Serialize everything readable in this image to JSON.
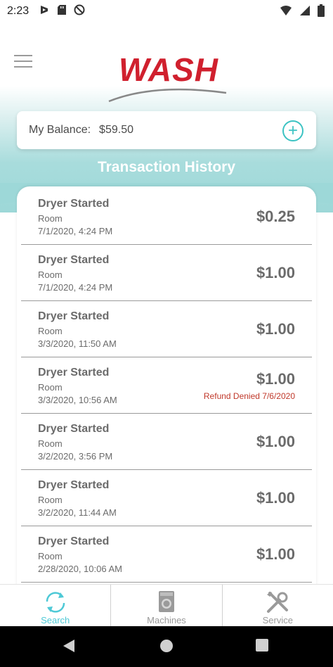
{
  "status_bar": {
    "time": "2:23"
  },
  "app": {
    "brand": "WASH"
  },
  "balance": {
    "label": "My Balance:",
    "value": "$59.50",
    "add_icon": "plus-circle-icon"
  },
  "section": {
    "title": "Transaction History"
  },
  "transactions": [
    {
      "title": "Dryer Started",
      "room": "Room",
      "date": "7/1/2020, 4:24 PM",
      "amount": "$0.25",
      "note": ""
    },
    {
      "title": "Dryer Started",
      "room": "Room",
      "date": "7/1/2020, 4:24 PM",
      "amount": "$1.00",
      "note": ""
    },
    {
      "title": "Dryer Started",
      "room": "Room",
      "date": "3/3/2020, 11:50 AM",
      "amount": "$1.00",
      "note": ""
    },
    {
      "title": "Dryer Started",
      "room": "Room",
      "date": "3/3/2020, 10:56 AM",
      "amount": "$1.00",
      "note": "Refund Denied 7/6/2020"
    },
    {
      "title": "Dryer Started",
      "room": "Room",
      "date": "3/2/2020, 3:56 PM",
      "amount": "$1.00",
      "note": ""
    },
    {
      "title": "Dryer Started",
      "room": "Room",
      "date": "3/2/2020, 11:44 AM",
      "amount": "$1.00",
      "note": ""
    },
    {
      "title": "Dryer Started",
      "room": "Room",
      "date": "2/28/2020, 10:06 AM",
      "amount": "$1.00",
      "note": ""
    }
  ],
  "bottom_nav": [
    {
      "label": "Search",
      "icon": "refresh-icon",
      "active": true
    },
    {
      "label": "Machines",
      "icon": "washer-icon",
      "active": false
    },
    {
      "label": "Service",
      "icon": "tools-icon",
      "active": false
    }
  ],
  "colors": {
    "accent": "#4ec9d6",
    "brand_red": "#d0202e",
    "refund_red": "#c0392b"
  }
}
